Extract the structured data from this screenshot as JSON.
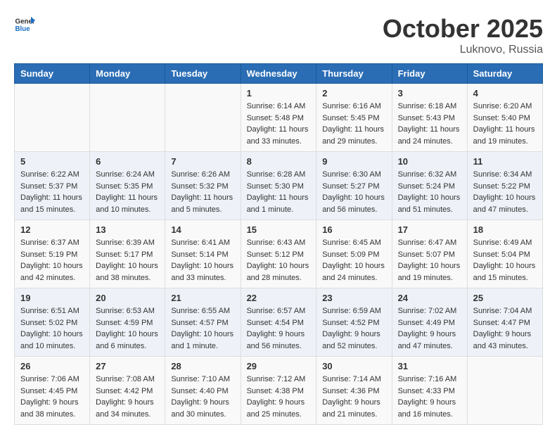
{
  "header": {
    "logo_general": "General",
    "logo_blue": "Blue",
    "title": "October 2025",
    "subtitle": "Luknovo, Russia"
  },
  "weekdays": [
    "Sunday",
    "Monday",
    "Tuesday",
    "Wednesday",
    "Thursday",
    "Friday",
    "Saturday"
  ],
  "weeks": [
    [
      {
        "day": "",
        "info": ""
      },
      {
        "day": "",
        "info": ""
      },
      {
        "day": "",
        "info": ""
      },
      {
        "day": "1",
        "info": "Sunrise: 6:14 AM\nSunset: 5:48 PM\nDaylight: 11 hours and 33 minutes."
      },
      {
        "day": "2",
        "info": "Sunrise: 6:16 AM\nSunset: 5:45 PM\nDaylight: 11 hours and 29 minutes."
      },
      {
        "day": "3",
        "info": "Sunrise: 6:18 AM\nSunset: 5:43 PM\nDaylight: 11 hours and 24 minutes."
      },
      {
        "day": "4",
        "info": "Sunrise: 6:20 AM\nSunset: 5:40 PM\nDaylight: 11 hours and 19 minutes."
      }
    ],
    [
      {
        "day": "5",
        "info": "Sunrise: 6:22 AM\nSunset: 5:37 PM\nDaylight: 11 hours and 15 minutes."
      },
      {
        "day": "6",
        "info": "Sunrise: 6:24 AM\nSunset: 5:35 PM\nDaylight: 11 hours and 10 minutes."
      },
      {
        "day": "7",
        "info": "Sunrise: 6:26 AM\nSunset: 5:32 PM\nDaylight: 11 hours and 5 minutes."
      },
      {
        "day": "8",
        "info": "Sunrise: 6:28 AM\nSunset: 5:30 PM\nDaylight: 11 hours and 1 minute."
      },
      {
        "day": "9",
        "info": "Sunrise: 6:30 AM\nSunset: 5:27 PM\nDaylight: 10 hours and 56 minutes."
      },
      {
        "day": "10",
        "info": "Sunrise: 6:32 AM\nSunset: 5:24 PM\nDaylight: 10 hours and 51 minutes."
      },
      {
        "day": "11",
        "info": "Sunrise: 6:34 AM\nSunset: 5:22 PM\nDaylight: 10 hours and 47 minutes."
      }
    ],
    [
      {
        "day": "12",
        "info": "Sunrise: 6:37 AM\nSunset: 5:19 PM\nDaylight: 10 hours and 42 minutes."
      },
      {
        "day": "13",
        "info": "Sunrise: 6:39 AM\nSunset: 5:17 PM\nDaylight: 10 hours and 38 minutes."
      },
      {
        "day": "14",
        "info": "Sunrise: 6:41 AM\nSunset: 5:14 PM\nDaylight: 10 hours and 33 minutes."
      },
      {
        "day": "15",
        "info": "Sunrise: 6:43 AM\nSunset: 5:12 PM\nDaylight: 10 hours and 28 minutes."
      },
      {
        "day": "16",
        "info": "Sunrise: 6:45 AM\nSunset: 5:09 PM\nDaylight: 10 hours and 24 minutes."
      },
      {
        "day": "17",
        "info": "Sunrise: 6:47 AM\nSunset: 5:07 PM\nDaylight: 10 hours and 19 minutes."
      },
      {
        "day": "18",
        "info": "Sunrise: 6:49 AM\nSunset: 5:04 PM\nDaylight: 10 hours and 15 minutes."
      }
    ],
    [
      {
        "day": "19",
        "info": "Sunrise: 6:51 AM\nSunset: 5:02 PM\nDaylight: 10 hours and 10 minutes."
      },
      {
        "day": "20",
        "info": "Sunrise: 6:53 AM\nSunset: 4:59 PM\nDaylight: 10 hours and 6 minutes."
      },
      {
        "day": "21",
        "info": "Sunrise: 6:55 AM\nSunset: 4:57 PM\nDaylight: 10 hours and 1 minute."
      },
      {
        "day": "22",
        "info": "Sunrise: 6:57 AM\nSunset: 4:54 PM\nDaylight: 9 hours and 56 minutes."
      },
      {
        "day": "23",
        "info": "Sunrise: 6:59 AM\nSunset: 4:52 PM\nDaylight: 9 hours and 52 minutes."
      },
      {
        "day": "24",
        "info": "Sunrise: 7:02 AM\nSunset: 4:49 PM\nDaylight: 9 hours and 47 minutes."
      },
      {
        "day": "25",
        "info": "Sunrise: 7:04 AM\nSunset: 4:47 PM\nDaylight: 9 hours and 43 minutes."
      }
    ],
    [
      {
        "day": "26",
        "info": "Sunrise: 7:06 AM\nSunset: 4:45 PM\nDaylight: 9 hours and 38 minutes."
      },
      {
        "day": "27",
        "info": "Sunrise: 7:08 AM\nSunset: 4:42 PM\nDaylight: 9 hours and 34 minutes."
      },
      {
        "day": "28",
        "info": "Sunrise: 7:10 AM\nSunset: 4:40 PM\nDaylight: 9 hours and 30 minutes."
      },
      {
        "day": "29",
        "info": "Sunrise: 7:12 AM\nSunset: 4:38 PM\nDaylight: 9 hours and 25 minutes."
      },
      {
        "day": "30",
        "info": "Sunrise: 7:14 AM\nSunset: 4:36 PM\nDaylight: 9 hours and 21 minutes."
      },
      {
        "day": "31",
        "info": "Sunrise: 7:16 AM\nSunset: 4:33 PM\nDaylight: 9 hours and 16 minutes."
      },
      {
        "day": "",
        "info": ""
      }
    ]
  ]
}
